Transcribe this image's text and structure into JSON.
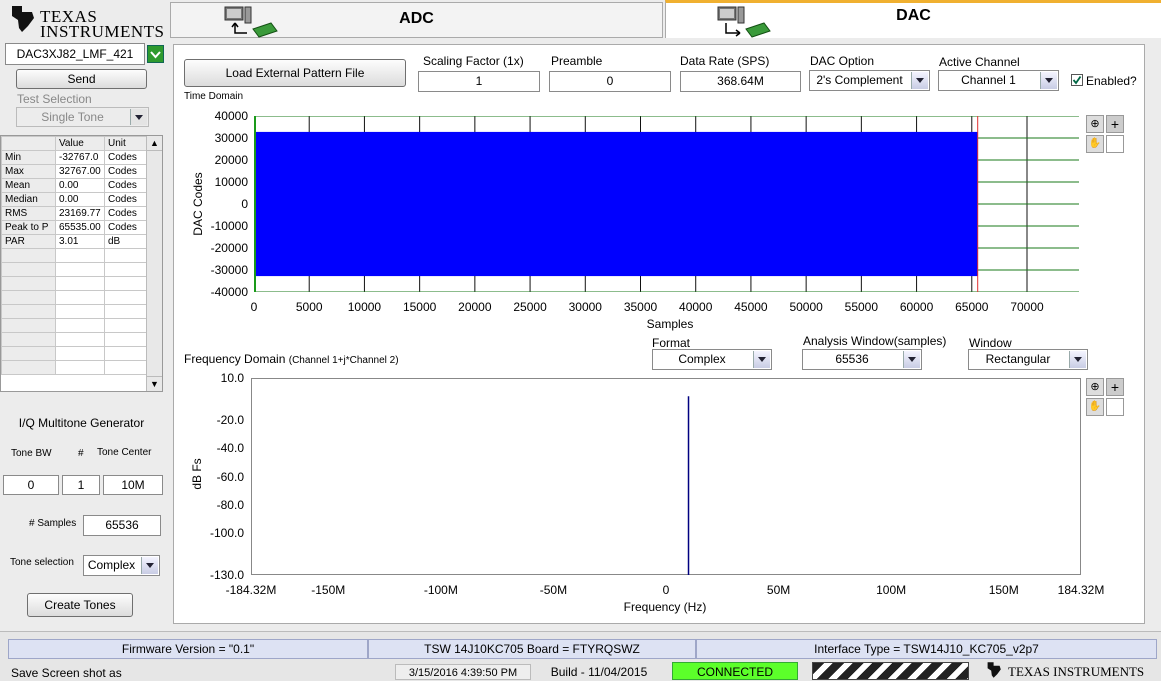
{
  "brand": {
    "line1": "Texas",
    "line2": "Instruments",
    "footer": "Texas Instruments"
  },
  "tabs": [
    {
      "label": "ADC",
      "active": false
    },
    {
      "label": "DAC",
      "active": true
    }
  ],
  "left": {
    "device_value": "DAC3XJ82_LMF_421",
    "send_label": "Send",
    "test_selection_label": "Test Selection",
    "test_selection_value": "Single Tone",
    "stats_headers": [
      "",
      "Value",
      "Unit"
    ],
    "stats": [
      {
        "name": "Min",
        "value": "-32767.0",
        "unit": "Codes"
      },
      {
        "name": "Max",
        "value": "32767.00",
        "unit": "Codes"
      },
      {
        "name": "Mean",
        "value": "0.00",
        "unit": "Codes"
      },
      {
        "name": "Median",
        "value": "0.00",
        "unit": "Codes"
      },
      {
        "name": "RMS",
        "value": "23169.77",
        "unit": "Codes"
      },
      {
        "name": "Peak to P",
        "value": "65535.00",
        "unit": "Codes"
      },
      {
        "name": "PAR",
        "value": "3.01",
        "unit": "dB"
      }
    ],
    "iq_title": "I/Q Multitone Generator",
    "tone_bw_label": "Tone BW",
    "count_label": "#",
    "tone_center_label": "Tone Center",
    "tone_bw": "0",
    "count": "1",
    "tone_center": "10M",
    "samples_label": "# Samples",
    "samples": "65536",
    "tone_sel_label": "Tone selection",
    "tone_sel": "Complex",
    "create_label": "Create Tones"
  },
  "controls": {
    "load_label": "Load External Pattern File",
    "scaling_label": "Scaling Factor (1x)",
    "scaling": "1",
    "preamble_label": "Preamble",
    "preamble": "0",
    "rate_label": "Data Rate (SPS)",
    "rate": "368.64M",
    "option_label": "DAC Option",
    "option": "2's Complement",
    "channel_label": "Active Channel",
    "channel": "Channel 1",
    "enabled_label": "Enabled?",
    "enabled": true
  },
  "time_chart": {
    "title": "Time Domain",
    "xlabel": "Samples",
    "ylabel": "DAC Codes",
    "xticks": [
      "0",
      "5000",
      "10000",
      "15000",
      "20000",
      "25000",
      "30000",
      "35000",
      "40000",
      "45000",
      "50000",
      "55000",
      "60000",
      "65000",
      "70000"
    ],
    "yticks": [
      "40000",
      "30000",
      "20000",
      "10000",
      "0",
      "-10000",
      "-20000",
      "-30000",
      "-40000"
    ]
  },
  "freq_controls": {
    "title": "Frequency Domain",
    "subtitle": "(Channel 1+j*Channel 2)",
    "format_label": "Format",
    "format": "Complex",
    "window_samples_label": "Analysis Window(samples)",
    "window_samples": "65536",
    "window_label": "Window",
    "window": "Rectangular"
  },
  "freq_chart": {
    "xlabel": "Frequency (Hz)",
    "ylabel": "dB Fs",
    "xticks": [
      "-184.32M",
      "-150M",
      "-100M",
      "-50M",
      "0",
      "50M",
      "100M",
      "150M",
      "184.32M"
    ],
    "yticks": [
      "10.0",
      "-20.0",
      "-40.0",
      "-60.0",
      "-80.0",
      "-100.0",
      "-130.0"
    ]
  },
  "chart_data": [
    {
      "type": "area",
      "title": "Time Domain",
      "xlabel": "Samples",
      "ylabel": "DAC Codes",
      "xlim": [
        0,
        70000
      ],
      "ylim": [
        -40000,
        40000
      ],
      "series": [
        {
          "x": [
            0,
            65535
          ],
          "min": [
            -32767,
            -32767
          ],
          "max": [
            32767,
            32767
          ]
        }
      ],
      "grid": true
    },
    {
      "type": "line",
      "title": "Frequency Domain",
      "xlabel": "Frequency (Hz)",
      "ylabel": "dB Fs",
      "xlim": [
        -184.32,
        184.32
      ],
      "x_unit": "MHz",
      "ylim": [
        -130,
        10
      ],
      "series": [
        {
          "x": [
            10,
            10
          ],
          "y": [
            -130,
            -3
          ]
        }
      ],
      "grid": false
    }
  ],
  "status_bar": {
    "firmware": "Firmware Version = \"0.1\"",
    "board": "TSW 14J10KC705 Board = FTYRQSWZ",
    "interface": "Interface Type = TSW14J10_KC705_v2p7",
    "save": "Save Screen shot as",
    "datetime": "3/15/2016 4:39:50 PM",
    "build": "Build  - 11/04/2015",
    "connection": "CONNECTED"
  },
  "colors": {
    "signal": "#0000ff",
    "connected": "#5cff2a",
    "accent": "#f0b030"
  }
}
